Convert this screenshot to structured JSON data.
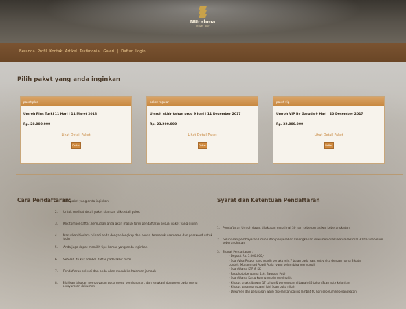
{
  "header": {
    "logo_text": "NUrahma",
    "logo_sub": "Travel Tour"
  },
  "nav": {
    "items": [
      "Beranda",
      "Profil",
      "Kontak",
      "Artikel",
      "Testimonial",
      "Galeri",
      "|",
      "Daftar",
      "Login"
    ]
  },
  "packages": {
    "title": "Pilih paket yang anda inginkan",
    "cards": [
      {
        "category": "paket plus",
        "name": "Umroh Plus Turki 11 Hari | 11 Maret 2018",
        "price": "Rp. 28.000.000",
        "detail_link": "Lihat Detail Paket",
        "button": "Daftar"
      },
      {
        "category": "paket regular",
        "name": "Umroh akhir tahun prog 9 hari | 11 Desember 2017",
        "price": "Rp. 23.200.000",
        "detail_link": "Lihat Detail Paket",
        "button": "Daftar"
      },
      {
        "category": "paket vip",
        "name": "Umroh VIP By Garuda 9 Hari | 20 Desember 2017",
        "price": "Rp. 32.000.000",
        "detail_link": "Lihat Detail Paket",
        "button": "Daftar"
      }
    ]
  },
  "cara": {
    "title": "Cara Pendaftaran:",
    "steps": [
      {
        "num": "1.",
        "text": "Pilih paket yang anda inginkan"
      },
      {
        "num": "2.",
        "text": "Untuk melihat detail paket silahkan klik detail paket"
      },
      {
        "num": "3.",
        "text": "Klik tombol daftar, kemudian anda akan masuk form pendaftaran sesuai paket yang dipilih"
      },
      {
        "num": "4.",
        "text": "Masukkan biodata pribadi anda dengan lengkap dan benar, termasuk username dan password untuk login"
      },
      {
        "num": "5.",
        "text": "Anda juga dapat memilih tipe kamar yang anda inginkan"
      },
      {
        "num": "6.",
        "text": "Setelah itu klik tombol daftar pada akhir form"
      },
      {
        "num": "7.",
        "text": "Pendaftaran selesai dan anda akan masuk ke halaman jamaah"
      },
      {
        "num": "8.",
        "text": "Silahkan lakukan pembayaran pada menu pembayaran, dan lengkapi dokumen pada menu persyaratan dokumen"
      }
    ]
  },
  "syarat": {
    "title": "Syarat dan Ketentuan Pendaftaran",
    "items": [
      {
        "num": "1.",
        "text": "Pendaftaran Umroh dapat dilakukan maksimal 30 hari sebelum jadwal keberangkatan."
      },
      {
        "num": "2.",
        "text": "pelunasan pembayaran Umroh  dan penyerahan kelengkapan dokumen dilakukan maksimal 30 hari sebelum keberangkatan."
      },
      {
        "num": "3.",
        "text": "Syarat Pendaftaran :"
      }
    ],
    "sub_items": [
      "-    Deposit Rp. 5.000.000,-",
      "-    Scan Visa Paspor yang masih berlaku min.7 bulan pada saat entry visa dengan nama 3 kata,",
      "      contoh: Muhammad Abadi Aulia (yang belum bisa menyusul)",
      "-    Scan Warna KTP & KK",
      "-    Pas photo berwarna 4x6, Bagroud Putih",
      "-    Scan Warna Kartu kuning vaksin meningitis",
      "-    Khusus anak dibawah 17 tahun & perempuan  dibawah 45 tahun Scan akte kelahiran",
      "-    Khusus pasangan suami istri Scan buku nikah",
      "-    Dokumen dan pelunasan wajib diserahkan paling lambat 60 hari sebelum keberangkatan"
    ]
  }
}
